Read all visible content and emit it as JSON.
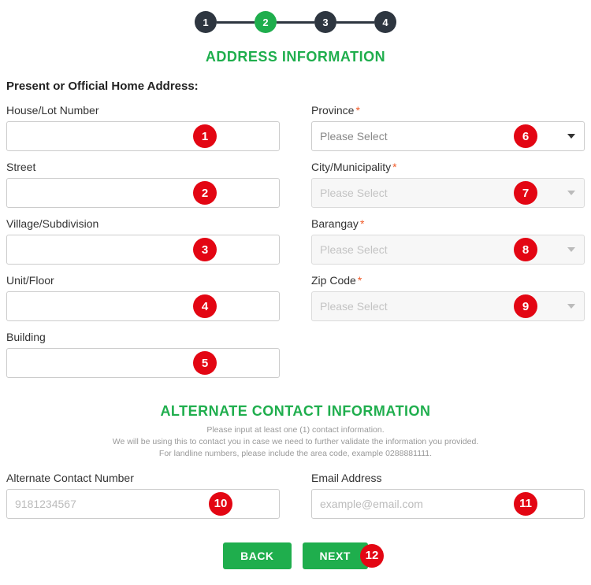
{
  "stepper": {
    "steps": [
      "1",
      "2",
      "3",
      "4"
    ],
    "active_index": 1
  },
  "section1": {
    "title": "ADDRESS INFORMATION",
    "heading": "Present or Official Home Address:"
  },
  "left": {
    "house": {
      "label": "House/Lot Number"
    },
    "street": {
      "label": "Street"
    },
    "village": {
      "label": "Village/Subdivision"
    },
    "unit": {
      "label": "Unit/Floor"
    },
    "building": {
      "label": "Building"
    }
  },
  "right": {
    "province": {
      "label": "Province",
      "required": "*",
      "placeholder": "Please Select"
    },
    "city": {
      "label": "City/Municipality",
      "required": "*",
      "placeholder": "Please Select"
    },
    "barangay": {
      "label": "Barangay",
      "required": "*",
      "placeholder": "Please Select"
    },
    "zip": {
      "label": "Zip Code",
      "required": "*",
      "placeholder": "Please Select"
    }
  },
  "section2": {
    "title": "ALTERNATE CONTACT INFORMATION",
    "note1": "Please input at least one (1) contact information.",
    "note2": "We will be using this to contact you in case we need to further validate the information you provided.",
    "note3": "For landline numbers, please include the area code, example 0288881111."
  },
  "alt": {
    "phone": {
      "label": "Alternate Contact  Number",
      "placeholder": "9181234567"
    },
    "email": {
      "label": "Email Address",
      "placeholder": "example@email.com"
    }
  },
  "buttons": {
    "back": "BACK",
    "next": "NEXT"
  },
  "markers": [
    "1",
    "2",
    "3",
    "4",
    "5",
    "6",
    "7",
    "8",
    "9",
    "10",
    "11",
    "12"
  ]
}
